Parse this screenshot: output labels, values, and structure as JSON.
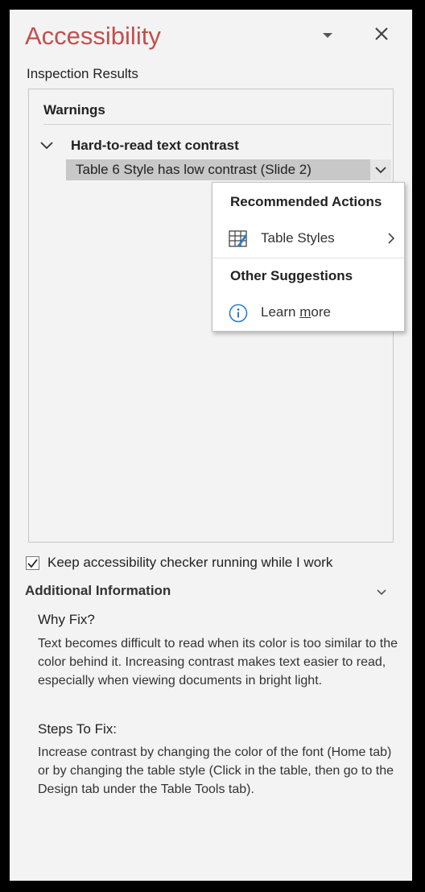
{
  "pane": {
    "title": "Accessibility",
    "options_icon": "chevron-down-icon",
    "close_icon": "close-icon"
  },
  "inspection_label": "Inspection Results",
  "results": {
    "section_heading": "Warnings",
    "issue": {
      "title": "Hard-to-read text contrast",
      "item": "Table 6 Style has low contrast (Slide 2)"
    }
  },
  "context_menu": {
    "recommended_heading": "Recommended Actions",
    "table_styles_label": "Table Styles",
    "other_heading": "Other Suggestions",
    "learn_more_prefix": "Learn ",
    "learn_more_underlined": "m",
    "learn_more_suffix": "ore"
  },
  "keep_running": {
    "label": "Keep accessibility checker running while I work",
    "checked": true
  },
  "additional_info": {
    "heading": "Additional Information",
    "why_heading": "Why Fix?",
    "why_text": "Text becomes difficult to read when its color is too similar to the color behind it. Increasing contrast makes text easier to read, especially when viewing documents in bright light.",
    "steps_heading": "Steps To Fix:",
    "steps_text": "Increase contrast by changing the color of the font (Home tab) or by changing the table style (Click in the table, then go to the Design tab under the Table Tools tab)."
  },
  "colors": {
    "title": "#c0504d",
    "selected_row": "#c8c8c8",
    "info_icon": "#2b7bd0"
  }
}
